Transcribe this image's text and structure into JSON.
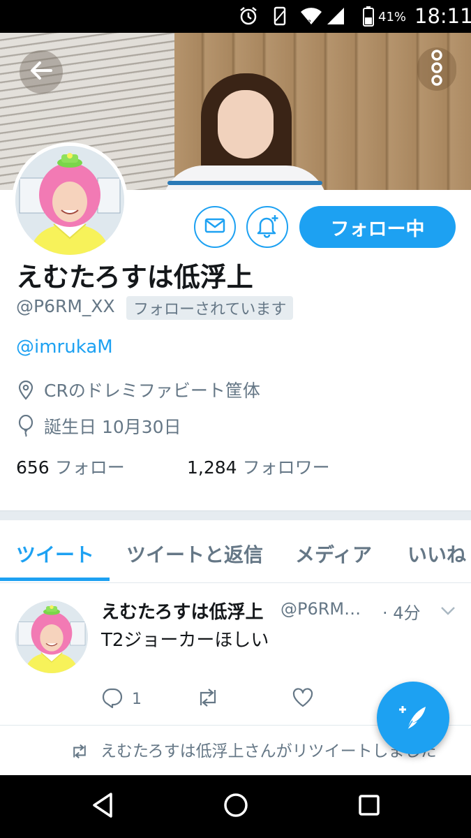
{
  "status_bar": {
    "battery_percent": "41%",
    "time": "18:11",
    "icons": [
      "alarm-icon",
      "vibrate-icon",
      "wifi-icon",
      "signal-icon",
      "battery-icon"
    ]
  },
  "header": {
    "back_icon": "back-arrow-icon",
    "menu_icon": "more-vertical-icon"
  },
  "profile": {
    "display_name": "えむたろすは低浮上",
    "handle": "@P6RM_XX",
    "follows_you_badge": "フォローされています",
    "bio_link": "@imrukaM",
    "location": "CRのドレミファビート筐体",
    "birthday": "誕生日 10月30日",
    "following_count": "656",
    "following_label": "フォロー",
    "followers_count": "1,284",
    "followers_label": "フォロワー",
    "follow_button_label": "フォロー中"
  },
  "tabs": [
    {
      "label": "ツイート",
      "active": true
    },
    {
      "label": "ツイートと返信",
      "active": false
    },
    {
      "label": "メディア",
      "active": false
    },
    {
      "label": "いいね",
      "active": false
    }
  ],
  "tweet": {
    "name": "えむたろすは低浮上",
    "handle": "@P6RM…",
    "time": "· 4分",
    "text": "T2ジョーカーほしい",
    "reply_count": "1",
    "retweet_count": "",
    "like_count": ""
  },
  "retweet_notice": {
    "text": "えむたろすは低浮上さんがリツイートしました"
  },
  "colors": {
    "accent": "#1da1f2",
    "secondary_text": "#657786",
    "primary_text": "#14171a",
    "divider": "#e6ecf0"
  }
}
